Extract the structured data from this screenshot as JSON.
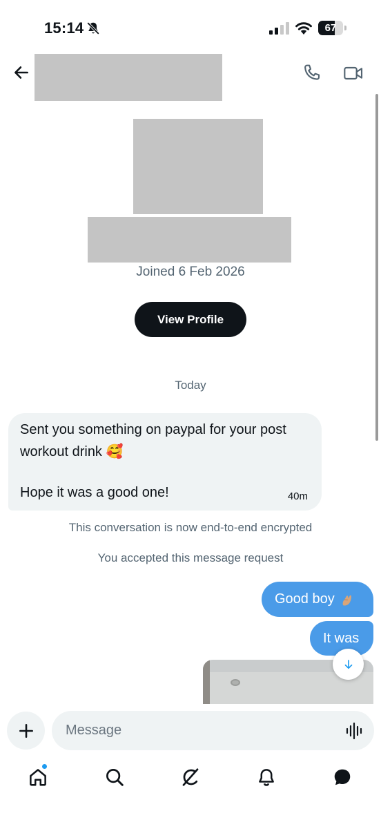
{
  "status_bar": {
    "time": "15:14",
    "battery": "67",
    "battery_level": 0.67
  },
  "header": {
    "back_icon": "arrow-left-icon",
    "call_icon": "phone-icon",
    "video_icon": "video-camera-icon"
  },
  "profile": {
    "joined": "Joined 6 Feb 2026",
    "view_profile_label": "View Profile"
  },
  "conversation": {
    "day_separator": "Today",
    "received": {
      "line1": "Sent you something on paypal for your post",
      "line2": "workout drink 🥰",
      "line3": "Hope it was a good one!",
      "time": "40m"
    },
    "system_notes": [
      "This conversation is now end-to-end encrypted",
      "You accepted this message request"
    ],
    "sent": [
      {
        "text": "Good boy"
      },
      {
        "text": "It was"
      }
    ]
  },
  "composer": {
    "placeholder": "Message",
    "plus_icon": "plus-icon",
    "voice_icon": "voice-waveform-icon"
  },
  "bottom_nav": {
    "items": [
      "home-icon",
      "search-icon",
      "grok-icon",
      "bell-icon",
      "messages-icon"
    ]
  },
  "colors": {
    "accent": "#1d9bf0",
    "sent_bubble": "#4a9be8",
    "received_bubble": "#eff3f4",
    "primary_button": "#0f1419",
    "secondary_text": "#536471"
  }
}
